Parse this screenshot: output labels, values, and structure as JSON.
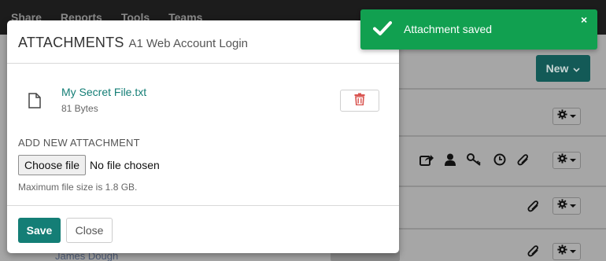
{
  "app": {
    "nav": [
      "Share",
      "Reports",
      "Tools",
      "Teams"
    ],
    "new_button": "New",
    "bg_row_name": "James Dough"
  },
  "modal": {
    "title": "ATTACHMENTS",
    "subtitle": "A1 Web Account Login",
    "file": {
      "name": "My Secret File.txt",
      "size": "81 Bytes"
    },
    "add_label": "ADD NEW ATTACHMENT",
    "choose_label": "Choose file",
    "no_file_text": "No file chosen",
    "hint": "Maximum file size is 1.8 GB.",
    "save_label": "Save",
    "close_label": "Close"
  },
  "toast": {
    "message": "Attachment saved",
    "close_glyph": "×"
  },
  "colors": {
    "accent": "#147e76",
    "toast": "#11a050",
    "danger": "#d9534f"
  }
}
